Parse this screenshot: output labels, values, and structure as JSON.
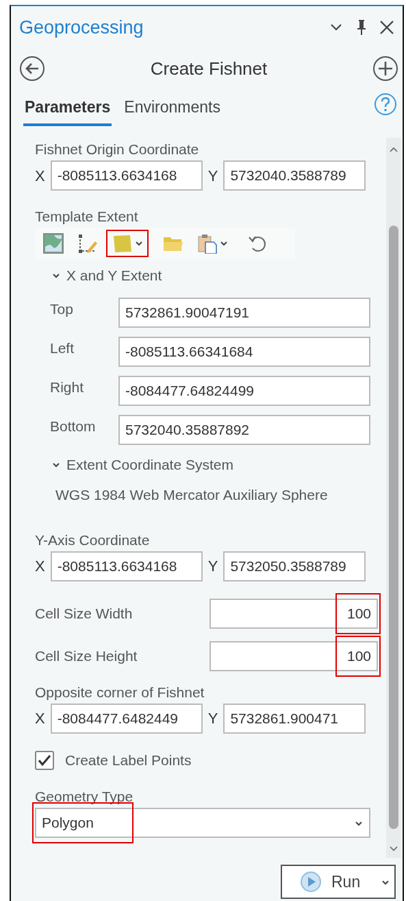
{
  "panel": {
    "title": "Geoprocessing",
    "tool_title": "Create Fishnet"
  },
  "tabs": [
    {
      "label": "Parameters",
      "selected": true
    },
    {
      "label": "Environments",
      "selected": false
    }
  ],
  "parameters": [
    {
      "kind": "xy",
      "label": "Fishnet Origin Coordinate",
      "x_label": "X",
      "x_value": "-8085113.6634168",
      "y_label": "Y",
      "y_value": "5732040.3588789"
    },
    {
      "kind": "extent",
      "label": "Template Extent",
      "tools": [
        {
          "kind": "map",
          "highlighted": false,
          "has_menu": false
        },
        {
          "kind": "draw",
          "highlighted": false,
          "has_menu": false
        },
        {
          "kind": "polygon",
          "highlighted": true,
          "has_menu": true
        },
        {
          "kind": "folder",
          "highlighted": false,
          "has_menu": false
        },
        {
          "kind": "paste",
          "highlighted": false,
          "has_menu": true
        },
        {
          "kind": "reset",
          "highlighted": false,
          "has_menu": false
        }
      ],
      "xy_section": {
        "title": "X and Y Extent",
        "expanded": true,
        "rows": [
          {
            "label": "Top",
            "value": "5732861.90047191"
          },
          {
            "label": "Left",
            "value": "-8085113.66341684"
          },
          {
            "label": "Right",
            "value": "-8084477.64824499"
          },
          {
            "label": "Bottom",
            "value": "5732040.35887892"
          }
        ]
      },
      "cs_section": {
        "title": "Extent Coordinate System",
        "expanded": true,
        "value": "WGS 1984 Web Mercator Auxiliary Sphere"
      }
    },
    {
      "kind": "xy",
      "label": "Y-Axis Coordinate",
      "x_label": "X",
      "x_value": "-8085113.6634168",
      "y_label": "Y",
      "y_value": "5732050.3588789"
    },
    {
      "kind": "number",
      "label": "Cell Size Width",
      "value": "100",
      "highlighted": true
    },
    {
      "kind": "number",
      "label": "Cell Size Height",
      "value": "100",
      "highlighted": true
    },
    {
      "kind": "xy",
      "label": "Opposite corner of Fishnet",
      "x_label": "X",
      "x_value": "-8084477.6482449",
      "y_label": "Y",
      "y_value": "5732861.900471"
    },
    {
      "kind": "checkbox",
      "label": "Create Label Points",
      "checked": true
    },
    {
      "kind": "dropdown",
      "label": "Geometry Type",
      "value": "Polygon",
      "highlighted": true
    }
  ],
  "run_button": {
    "label": "Run"
  }
}
